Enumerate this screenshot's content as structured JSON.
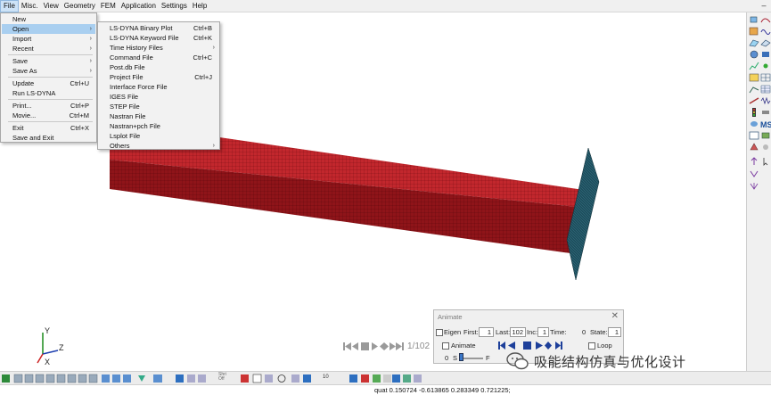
{
  "menubar": {
    "items": [
      "File",
      "Misc.",
      "View",
      "Geometry",
      "FEM",
      "Application",
      "Settings",
      "Help"
    ],
    "minimize_glyph": "–"
  },
  "file_menu": {
    "items": [
      {
        "label": "New",
        "shortcut": ""
      },
      {
        "label": "Open",
        "shortcut": "",
        "arrow": "›"
      },
      {
        "label": "Import",
        "shortcut": "",
        "arrow": "›"
      },
      {
        "label": "Recent",
        "shortcut": "",
        "arrow": "›"
      },
      {
        "label": "Save",
        "shortcut": "",
        "arrow": "›"
      },
      {
        "label": "Save As",
        "shortcut": "",
        "arrow": "›"
      },
      {
        "label": "Update",
        "shortcut": "Ctrl+U"
      },
      {
        "label": "Run LS-DYNA",
        "shortcut": ""
      },
      {
        "label": "Print...",
        "shortcut": "Ctrl+P"
      },
      {
        "label": "Movie...",
        "shortcut": "Ctrl+M"
      },
      {
        "label": "Exit",
        "shortcut": "Ctrl+X"
      },
      {
        "label": "Save and Exit",
        "shortcut": ""
      }
    ]
  },
  "open_submenu": {
    "items": [
      {
        "label": "LS-DYNA Binary Plot",
        "shortcut": "Ctrl+B"
      },
      {
        "label": "LS-DYNA Keyword File",
        "shortcut": "Ctrl+K"
      },
      {
        "label": "Time History Files",
        "shortcut": "",
        "arrow": "›"
      },
      {
        "label": "Command File",
        "shortcut": "Ctrl+C"
      },
      {
        "label": "Post.db File",
        "shortcut": ""
      },
      {
        "label": "Project File",
        "shortcut": "Ctrl+J"
      },
      {
        "label": "Interface Force File",
        "shortcut": ""
      },
      {
        "label": "IGES File",
        "shortcut": ""
      },
      {
        "label": "STEP File",
        "shortcut": ""
      },
      {
        "label": "Nastran File",
        "shortcut": ""
      },
      {
        "label": "Nastran+pch File",
        "shortcut": ""
      },
      {
        "label": "Lsplot File",
        "shortcut": ""
      },
      {
        "label": "Others",
        "shortcut": "",
        "arrow": "›"
      }
    ]
  },
  "animate": {
    "title": "Animate",
    "close": "✕",
    "eigen_label": "Eigen",
    "first_label": "First:",
    "first_value": "1",
    "last_label": "Last:",
    "last_value": "102",
    "inc_label": "Inc:",
    "inc_value": "1",
    "time_label": "Time:",
    "time_value": "0",
    "state_label": "State:",
    "state_value": "1",
    "animate_label": "Animate",
    "loop_label": "Loop",
    "speed_value": "0",
    "s_label": "S",
    "f_label": "F"
  },
  "playback": {
    "frame_counter": "1/102"
  },
  "watermark": {
    "text": "吸能结构仿真与优化设计"
  },
  "triad": {
    "y": "Y",
    "z": "Z",
    "x": "X"
  },
  "bottom_toolbar": {
    "shrink_label": "Shri\nOff",
    "zoom_value": "10"
  },
  "status": {
    "text": "quat 0.150724 -0.613865 0.283349 0.721225;"
  },
  "colors": {
    "beam_top": "#c2272d",
    "beam_side": "#8f1419",
    "plate": "#1f4f5e",
    "menu_highlight": "#a9cff0"
  }
}
